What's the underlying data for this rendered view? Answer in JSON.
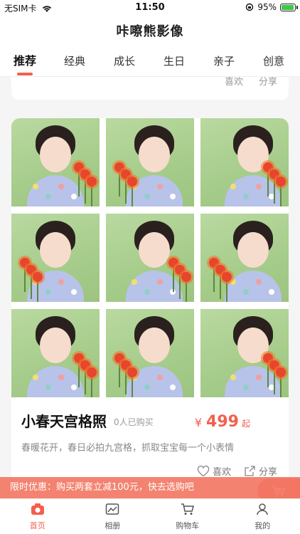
{
  "status_bar": {
    "carrier": "无SIM卡",
    "time": "11:50",
    "battery": "95%",
    "battery_level": 0.95
  },
  "app": {
    "title": "咔嚓熊影像"
  },
  "tabs": [
    {
      "label": "推荐",
      "active": true
    },
    {
      "label": "经典",
      "active": false
    },
    {
      "label": "成长",
      "active": false
    },
    {
      "label": "生日",
      "active": false
    },
    {
      "label": "亲子",
      "active": false
    },
    {
      "label": "创意",
      "active": false
    }
  ],
  "prev_card": {
    "like_label": "喜欢",
    "share_label": "分享"
  },
  "product": {
    "title": "小春天宫格照",
    "sold": "0人已购买",
    "price_symbol": "¥",
    "price": "499",
    "price_unit": "起",
    "description": "春暖花开，春日必拍九宫格，抓取宝宝每一个小表情",
    "like_label": "喜欢",
    "share_label": "分享"
  },
  "promo": {
    "text": "限时优惠：购买两套立减100元，快去选购吧"
  },
  "bottom_nav": [
    {
      "label": "首页",
      "icon": "home-camera-icon",
      "active": true
    },
    {
      "label": "相册",
      "icon": "album-icon",
      "active": false
    },
    {
      "label": "购物车",
      "icon": "cart-icon",
      "active": false
    },
    {
      "label": "我的",
      "icon": "profile-icon",
      "active": false
    }
  ],
  "colors": {
    "accent": "#f2604f",
    "photo_bg": "#a6cc8b"
  }
}
